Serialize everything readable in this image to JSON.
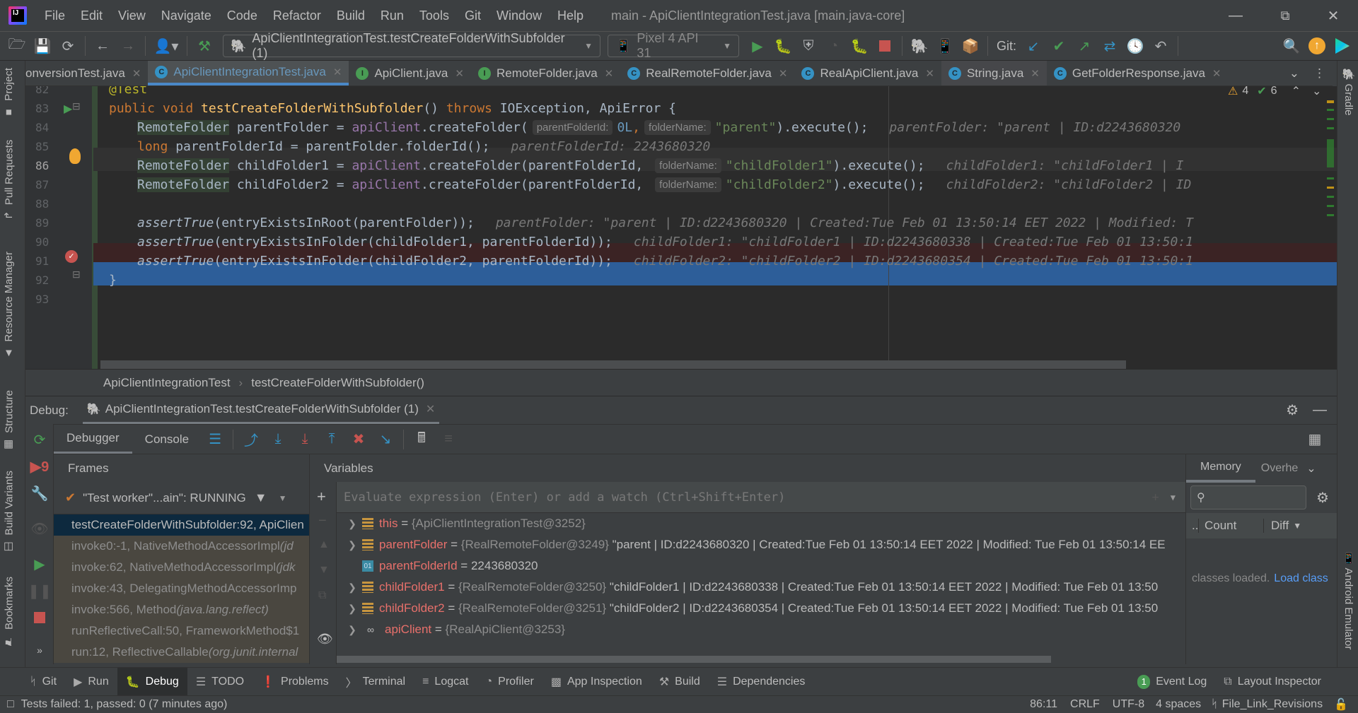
{
  "titlebar": {
    "menu": [
      "File",
      "Edit",
      "View",
      "Navigate",
      "Code",
      "Refactor",
      "Build",
      "Run",
      "Tools",
      "Git",
      "Window",
      "Help"
    ],
    "window_title": "main - ApiClientIntegrationTest.java [main.java-core]"
  },
  "toolbar": {
    "run_config": "ApiClientIntegrationTest.testCreateFolderWithSubfolder (1)",
    "device": "Pixel 4 API 31",
    "git_label": "Git:"
  },
  "tabs": [
    {
      "label": "onversionTest.java",
      "type": "c"
    },
    {
      "label": "ApiClientIntegrationTest.java",
      "type": "c",
      "active": true
    },
    {
      "label": "ApiClient.java",
      "type": "i"
    },
    {
      "label": "RemoteFolder.java",
      "type": "i"
    },
    {
      "label": "RealRemoteFolder.java",
      "type": "c"
    },
    {
      "label": "RealApiClient.java",
      "type": "c"
    },
    {
      "label": "String.java",
      "type": "c"
    },
    {
      "label": "GetFolderResponse.java",
      "type": "c"
    }
  ],
  "left_tools": [
    "Project",
    "Pull Requests",
    "Resource Manager",
    "Structure",
    "Build Variants",
    "Bookmarks"
  ],
  "right_tools": [
    "Gradle",
    "Android Emulator"
  ],
  "editor": {
    "inspections": {
      "warnings": "4",
      "weak_warnings": "6"
    },
    "line_numbers": [
      "82",
      "83",
      "84",
      "85",
      "86",
      "87",
      "88",
      "89",
      "90",
      "91",
      "92",
      "93"
    ],
    "lines": {
      "l82": "@Test",
      "l83_kw1": "public void ",
      "l83_fn": "testCreateFolderWithSubfolder",
      "l83_rest1": "() ",
      "l83_kw2": "throws ",
      "l83_rest2": "IOException, ApiError {",
      "type": "RemoteFolder",
      "l84_a": " parentFolder = ",
      "apiClient": "apiClient",
      "l84_b": ".createFolder(",
      "hint_parentFolderId": "parentFolderId:",
      "l84_num": "0L",
      "hint_folderName": "folderName:",
      "l84_str": "\"parent\"",
      "l84_c": ").execute();",
      "l84_dbg": "parentFolder: \"parent | ID:d2243680320",
      "l85_kw": "long",
      "l85_a": " parentFolderId = parentFolder.folderId();",
      "l85_dbg": "parentFolderId: 2243680320",
      "l86_a": " childFolder1 = ",
      "l86_b": ".createFolder(parentFolderId, ",
      "l86_str": "\"childFolder1\"",
      "l86_c": ").execute();",
      "l86_dbg": "childFolder1: \"childFolder1 | I",
      "l87_a": " childFolder2 = ",
      "l87_b": ".createFolder(parentFolderId, ",
      "l87_str": "\"childFolder2\"",
      "l87_c": ").execute();",
      "l87_dbg": "childFolder2: \"childFolder2 | ID",
      "assert": "assertTrue",
      "l89_a": "(entryExistsInRoot(parentFolder));",
      "l89_dbg": "parentFolder: \"parent | ID:d2243680320 | Created:Tue Feb 01 13:50:14 EET 2022 | Modified: T",
      "l90_a": "(entryExistsInFolder(childFolder1, parentFolderId));",
      "l90_dbg": "childFolder1: \"childFolder1 | ID:d2243680338 | Created:Tue Feb 01 13:50:1",
      "l91_a": "(entryExistsInFolder(childFolder2, parentFolderId));",
      "l91_dbg": "childFolder2: \"childFolder2 | ID:d2243680354 | Created:Tue Feb 01 13:50:1",
      "l92": "}"
    }
  },
  "breadcrumb": [
    "ApiClientIntegrationTest",
    "testCreateFolderWithSubfolder()"
  ],
  "debug": {
    "label": "Debug:",
    "session": "ApiClientIntegrationTest.testCreateFolderWithSubfolder (1)",
    "tabs": [
      "Debugger",
      "Console"
    ],
    "frames_title": "Frames",
    "variables_title": "Variables",
    "thread": "\"Test worker\"...ain\": RUNNING",
    "frames": [
      {
        "text": "testCreateFolderWithSubfolder:92, ApiClien",
        "pkg": ""
      },
      {
        "text": "invoke0:-1, NativeMethodAccessorImpl ",
        "pkg": "(jd"
      },
      {
        "text": "invoke:62, NativeMethodAccessorImpl ",
        "pkg": "(jdk"
      },
      {
        "text": "invoke:43, DelegatingMethodAccessorImp",
        "pkg": ""
      },
      {
        "text": "invoke:566, Method ",
        "pkg": "(java.lang.reflect)"
      },
      {
        "text": "runReflectiveCall:50, FrameworkMethod$1",
        "pkg": ""
      },
      {
        "text": "run:12, ReflectiveCallable ",
        "pkg": "(org.junit.internal"
      }
    ],
    "eval_placeholder": "Evaluate expression (Enter) or add a watch (Ctrl+Shift+Enter)",
    "variables": [
      {
        "name": "this",
        "type": "{ApiClientIntegrationTest@3252}",
        "value": "",
        "icon": "obj",
        "expandable": true
      },
      {
        "name": "parentFolder",
        "type": "{RealRemoteFolder@3249}",
        "value": "\"parent | ID:d2243680320 | Created:Tue Feb 01 13:50:14 EET 2022 | Modified: Tue Feb 01 13:50:14 EE",
        "icon": "obj",
        "expandable": true
      },
      {
        "name": "parentFolderId",
        "type": "",
        "value": "2243680320",
        "icon": "prim",
        "expandable": false
      },
      {
        "name": "childFolder1",
        "type": "{RealRemoteFolder@3250}",
        "value": "\"childFolder1 | ID:d2243680338 | Created:Tue Feb 01 13:50:14 EET 2022 | Modified: Tue Feb 01 13:50",
        "icon": "obj",
        "expandable": true
      },
      {
        "name": "childFolder2",
        "type": "{RealRemoteFolder@3251}",
        "value": "\"childFolder2 | ID:d2243680354 | Created:Tue Feb 01 13:50:14 EET 2022 | Modified: Tue Feb 01 13:50",
        "icon": "obj",
        "expandable": true
      },
      {
        "name": "apiClient",
        "type": "{RealApiClient@3253}",
        "value": "",
        "icon": "watch",
        "expandable": true
      }
    ],
    "memory": {
      "tabs": [
        "Memory",
        "Overhe"
      ],
      "col_dots": "..",
      "col_count": "Count",
      "col_diff": "Diff",
      "classes_loaded": "classes loaded.",
      "load_link": "Load class"
    }
  },
  "tool_windows": [
    "Git",
    "Run",
    "Debug",
    "TODO",
    "Problems",
    "Terminal",
    "Logcat",
    "Profiler",
    "App Inspection",
    "Build",
    "Dependencies"
  ],
  "tool_windows_right": {
    "event_log_count": "1",
    "event_log": "Event Log",
    "layout_inspector": "Layout Inspector"
  },
  "status": {
    "message": "Tests failed: 1, passed: 0 (7 minutes ago)",
    "position": "86:11",
    "line_sep": "CRLF",
    "encoding": "UTF-8",
    "indent": "4 spaces",
    "branch": "File_Link_Revisions"
  },
  "colors": {
    "accent": "#4a88c7",
    "selection_line": "#2d5e99",
    "error_line": "#3b2324",
    "run_green": "#499c54",
    "stop_red": "#c75450"
  }
}
